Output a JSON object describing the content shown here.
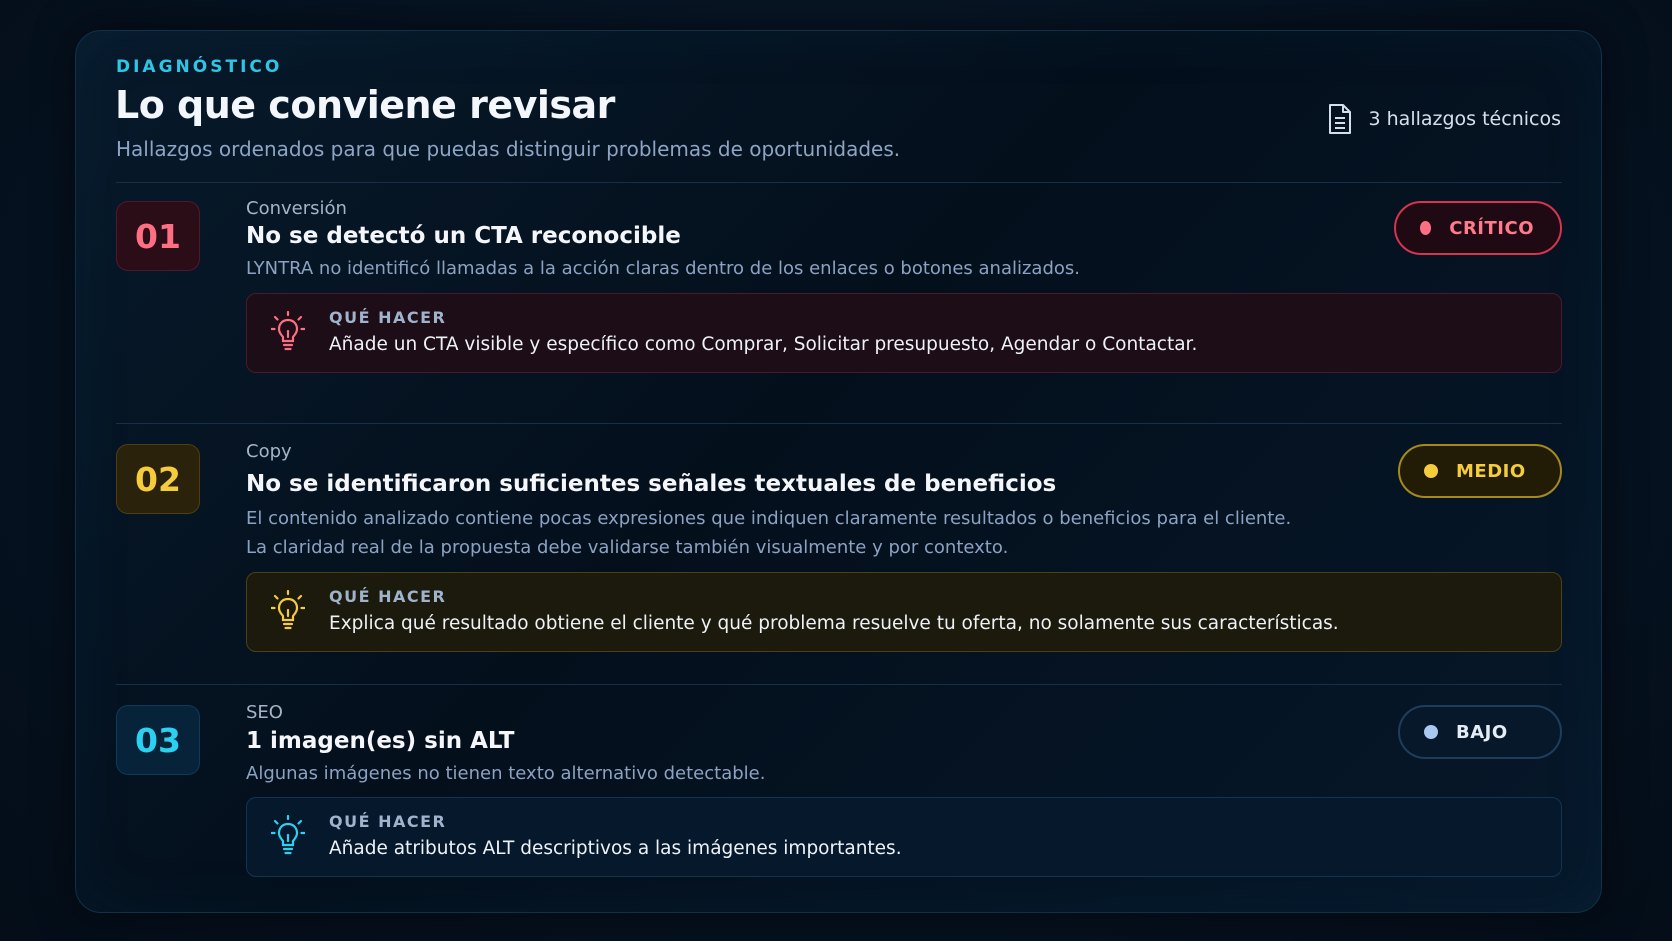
{
  "header": {
    "eyebrow": "DIAGNÓSTICO",
    "title": "Lo que conviene revisar",
    "subtitle": "Hallazgos ordenados para que puedas distinguir problemas de oportunidades.",
    "count_label": "3 hallazgos técnicos",
    "count_icon": "document-icon"
  },
  "colors": {
    "accent": "#2fc6e6",
    "critical": "#ff6f84",
    "medium": "#f5cc3c",
    "low": "#a8c8f0"
  },
  "findings": [
    {
      "number": "01",
      "category": "Conversión",
      "title": "No se detectó un CTA reconocible",
      "description": [
        "LYNTRA no identificó llamadas a la acción claras dentro de los enlaces o botones analizados."
      ],
      "badge": "CRÍTICO",
      "tip_label": "QUÉ HACER",
      "tip_text": "Añade un CTA visible y específico como Comprar, Solicitar presupuesto, Agendar o Contactar.",
      "tip_icon": "lightbulb-icon"
    },
    {
      "number": "02",
      "category": "Copy",
      "title": "No se identificaron suficientes señales textuales de beneficios",
      "description": [
        "El contenido analizado contiene pocas expresiones que indiquen claramente resultados o beneficios para el cliente.",
        "La claridad real de la propuesta debe validarse también visualmente y por contexto."
      ],
      "badge": "MEDIO",
      "tip_label": "QUÉ HACER",
      "tip_text": "Explica qué resultado obtiene el cliente y qué problema resuelve tu oferta, no solamente sus características.",
      "tip_icon": "lightbulb-icon"
    },
    {
      "number": "03",
      "category": "SEO",
      "title": "1 imagen(es) sin ALT",
      "description": [
        "Algunas imágenes no tienen texto alternativo detectable."
      ],
      "badge": "BAJO",
      "tip_label": "QUÉ HACER",
      "tip_text": "Añade atributos ALT descriptivos a las imágenes importantes.",
      "tip_icon": "lightbulb-icon"
    }
  ]
}
